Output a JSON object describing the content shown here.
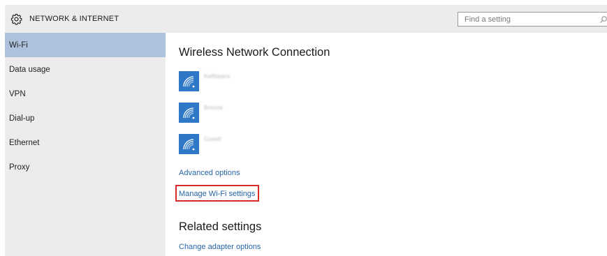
{
  "header": {
    "title": "NETWORK & INTERNET",
    "icon": "gear-icon"
  },
  "search": {
    "placeholder": "Find a setting",
    "icon": "search-icon"
  },
  "sidebar": {
    "items": [
      {
        "label": "Wi-Fi",
        "active": true
      },
      {
        "label": "Data usage",
        "active": false
      },
      {
        "label": "VPN",
        "active": false
      },
      {
        "label": "Dial-up",
        "active": false
      },
      {
        "label": "Ethernet",
        "active": false
      },
      {
        "label": "Proxy",
        "active": false
      }
    ]
  },
  "main": {
    "title": "Wireless Network Connection",
    "networks": [
      {
        "name": "Kellhpans",
        "icon": "wifi-icon"
      },
      {
        "name": "Brevne",
        "icon": "wifi-icon"
      },
      {
        "name": "Cosett",
        "icon": "wifi-icon"
      }
    ],
    "advanced_options": "Advanced options",
    "manage_wifi": "Manage Wi-Fi settings",
    "related_title": "Related settings",
    "change_adapter": "Change adapter options"
  },
  "colors": {
    "active_nav": "#aec2dd",
    "link": "#2764a8",
    "wifi_tile": "#2f78c8",
    "highlight": "#d92a2a"
  }
}
